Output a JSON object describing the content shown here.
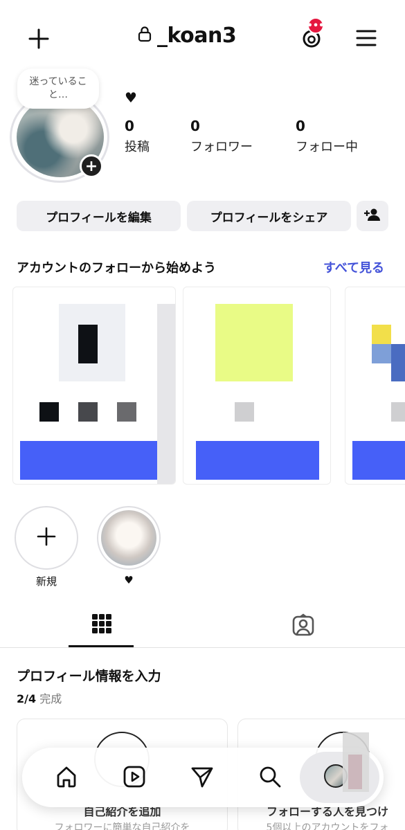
{
  "header": {
    "username": "_koan3",
    "threads_badge": "•••"
  },
  "profile": {
    "note_text": "迷っていること…",
    "bio_heart": "♥",
    "stats": [
      {
        "value": "0",
        "label": "投稿"
      },
      {
        "value": "0",
        "label": "フォロワー"
      },
      {
        "value": "0",
        "label": "フォロー中"
      }
    ]
  },
  "actions": {
    "edit_profile": "プロフィールを編集",
    "share_profile": "プロフィールをシェア"
  },
  "suggestions": {
    "title": "アカウントのフォローから始めよう",
    "see_all": "すべて見る"
  },
  "highlights": [
    {
      "label": "新規"
    },
    {
      "label": "♥"
    }
  ],
  "profile_info": {
    "title": "プロフィール情報を入力",
    "progress_count": "2/4",
    "progress_label": "完成",
    "cards": [
      {
        "title": "自己紹介を追加",
        "subtitle": "フォロワーに簡単な自己紹介を"
      },
      {
        "title": "フォローする人を見つけ",
        "subtitle": "5個以上のアカウントをフォ"
      }
    ]
  },
  "colors": {
    "accent_link": "#4453d9",
    "badge_red": "#e5173f",
    "button_bg": "#efeff2",
    "card_blue": "#4660f8",
    "card_yellow": "#e9fb86"
  }
}
